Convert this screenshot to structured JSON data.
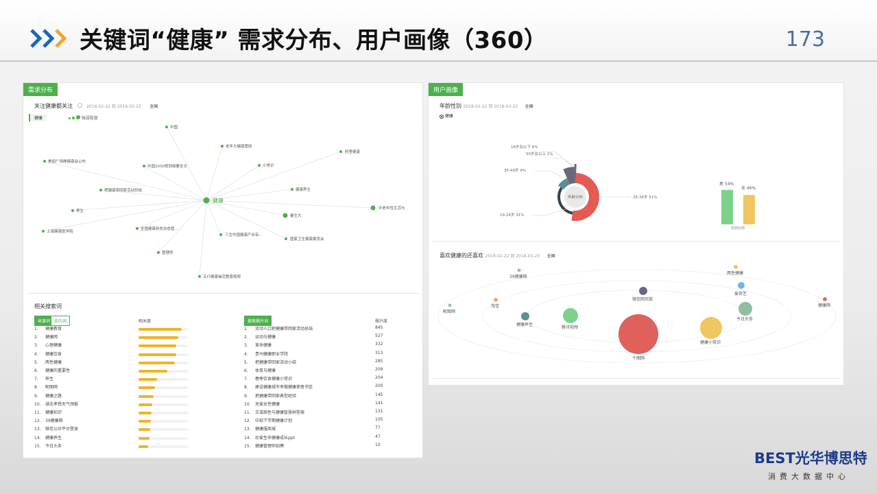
{
  "header": {
    "title": "关键词“健康” 需求分布、用户画像（360）",
    "page_number": "173"
  },
  "demand_panel": {
    "tag": "需求分布",
    "subtitle": "关注健康都关注",
    "date_range": "2018-02-22 到 2018-03-23",
    "region": "全国",
    "keyword_chip": "健康",
    "legend_label": "强弱程度",
    "center_node": "健康",
    "nodes": [
      "中国",
      "新东方烹饪学校",
      "三生中国健康产业有...",
      "老年大健康管网",
      "阿里健康",
      "小常识",
      "中国2030规划纲要全文",
      "美丽广场睡健康会公布",
      "把健康带回家活动总结",
      "健康养生",
      "养生",
      "中老年性生活与",
      "春生大",
      "上海健康医学院",
      "全国健康扶贫动态管...",
      "国家卫生健康委员会",
      "管理师",
      "五行健康操完整版视频"
    ]
  },
  "search_panel": {
    "title": "相关搜索词",
    "chip_active": "来源词",
    "chip_inactive": "去向词",
    "relevance_header": "相关度",
    "chip_rising": "搜索飙升词",
    "rising_header": "飙升度",
    "left_rows": [
      {
        "rank": "1.",
        "word": "健康教育",
        "pct": 88
      },
      {
        "rank": "2.",
        "word": "健康网",
        "pct": 80
      },
      {
        "rank": "3.",
        "word": "心理健康",
        "pct": 77
      },
      {
        "rank": "4.",
        "word": "健康饮食",
        "pct": 76
      },
      {
        "rank": "5.",
        "word": "两性健康",
        "pct": 73
      },
      {
        "rank": "6.",
        "word": "健康的重要性",
        "pct": 58
      },
      {
        "rank": "7.",
        "word": "养生",
        "pct": 38
      },
      {
        "rank": "8.",
        "word": "昵图网",
        "pct": 34
      },
      {
        "rank": "9.",
        "word": "健康之路",
        "pct": 30
      },
      {
        "rank": "10.",
        "word": "湖北孝感天气预报",
        "pct": 28
      },
      {
        "rank": "11.",
        "word": "健康知识",
        "pct": 26
      },
      {
        "rank": "12.",
        "word": "39健康网",
        "pct": 25
      },
      {
        "rank": "13.",
        "word": "微信公众平台登录",
        "pct": 24
      },
      {
        "rank": "14.",
        "word": "健康养生",
        "pct": 22
      },
      {
        "rank": "15.",
        "word": "今日头条",
        "pct": 20
      }
    ],
    "right_rows": [
      {
        "rank": "1.",
        "word": "流动人口把健康带回家活动总结",
        "value": "845"
      },
      {
        "rank": "2.",
        "word": "运动与健康",
        "value": "527"
      },
      {
        "rank": "3.",
        "word": "革命健康",
        "value": "332"
      },
      {
        "rank": "4.",
        "word": "贵州健康职业学院",
        "value": "313"
      },
      {
        "rank": "5.",
        "word": "把健康带回家活动小结",
        "value": "285"
      },
      {
        "rank": "6.",
        "word": "体育与健康",
        "value": "209"
      },
      {
        "rank": "7.",
        "word": "春季饮食健康小常识",
        "value": "204"
      },
      {
        "rank": "8.",
        "word": "建设健康城市争做健康使者书信",
        "value": "200"
      },
      {
        "rank": "9.",
        "word": "把健康带回家典型经验",
        "value": "145"
      },
      {
        "rank": "10.",
        "word": "关爱女性健康",
        "value": "141"
      },
      {
        "rank": "11.",
        "word": "艾滋病性与健康智慧树答案",
        "value": "131"
      },
      {
        "rank": "12.",
        "word": "中招下学期健康计划",
        "value": "105"
      },
      {
        "rank": "13.",
        "word": "健康服商城",
        "value": "77"
      },
      {
        "rank": "14.",
        "word": "珍爱生命健康成长ppt",
        "value": "47"
      },
      {
        "rank": "15.",
        "word": "健康管理师招聘",
        "value": "10"
      }
    ]
  },
  "profile_panel": {
    "tag": "用户画像",
    "age_title": "年龄性别",
    "date_range": "2018-02-22 到 2018-03-23",
    "region": "全国",
    "radio_label": "健康",
    "donut_center": "年龄分布",
    "gender_axis_label": "性别比例",
    "colors": {
      "age_25_34": "#e55a53",
      "age_19_24": "#36414a",
      "age_35_49": "#5c8f96",
      "age_50": "#6a6778",
      "male": "#7dd18a",
      "female": "#efc65f"
    }
  },
  "chart_data": [
    {
      "type": "pie",
      "categories": [
        "18岁及以下",
        "19-24岁",
        "25-34岁",
        "35-49岁",
        "50岁及以上"
      ],
      "labels": [
        "18岁及以下 6%",
        "19-24岁 31%",
        "25-34岁 51%",
        "35-49岁 9%",
        "50岁及以上 1%"
      ],
      "values": [
        6,
        31,
        51,
        9,
        1
      ]
    },
    {
      "type": "bar",
      "categories": [
        "男",
        "女"
      ],
      "labels": [
        "男 54%",
        "女 46%"
      ],
      "values": [
        54,
        46
      ],
      "xlabel": "性别比例"
    }
  ],
  "likes_panel": {
    "title": "喜欢健康的还喜欢",
    "date_range": "2018-02-22 到 2018-03-23",
    "region": "全国",
    "items": [
      {
        "label": "39健康网",
        "color": "#8fc98f"
      },
      {
        "label": "两性健康",
        "color": "#efc65f"
      },
      {
        "label": "爱奇艺",
        "color": "#6fb6e8"
      },
      {
        "label": "健康网",
        "color": "#d9735f"
      },
      {
        "label": "昵图网",
        "color": "#8fc9a6"
      },
      {
        "label": "淘宝",
        "color": "#f0a868"
      },
      {
        "label": "微信网页版",
        "color": "#6b6585"
      },
      {
        "label": "健康养生",
        "color": "#5f8f8f"
      },
      {
        "label": "腾讯视频",
        "color": "#7dd18a"
      },
      {
        "label": "今日头条",
        "color": "#8fbf9f"
      },
      {
        "label": "健康小常识",
        "color": "#efc65f"
      },
      {
        "label": "千图网",
        "color": "#e0605c"
      }
    ]
  },
  "logo": {
    "brand": "BEST光华博思特",
    "tagline": "消费大数据中心"
  }
}
